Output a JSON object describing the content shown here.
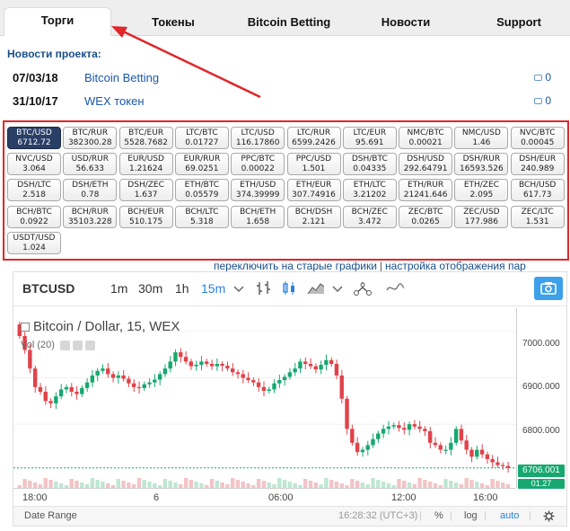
{
  "tabs": [
    "Торги",
    "Токены",
    "Bitcoin Betting",
    "Новости",
    "Support"
  ],
  "news": {
    "title": "Новости проекта:",
    "items": [
      {
        "date": "07/03/18",
        "text": "Bitcoin Betting",
        "count": "0"
      },
      {
        "date": "31/10/17",
        "text": "WEX токен",
        "count": "0"
      }
    ]
  },
  "pairs": [
    {
      "name": "BTC/USD",
      "price": "6712.72",
      "active": true
    },
    {
      "name": "BTC/RUR",
      "price": "382300.28"
    },
    {
      "name": "BTC/EUR",
      "price": "5528.7682"
    },
    {
      "name": "LTC/BTC",
      "price": "0.01727"
    },
    {
      "name": "LTC/USD",
      "price": "116.17860"
    },
    {
      "name": "LTC/RUR",
      "price": "6599.2426"
    },
    {
      "name": "LTC/EUR",
      "price": "95.691"
    },
    {
      "name": "NMC/BTC",
      "price": "0.00021"
    },
    {
      "name": "NMC/USD",
      "price": "1.46"
    },
    {
      "name": "NVC/BTC",
      "price": "0.00045"
    },
    {
      "name": "NVC/USD",
      "price": "3.064"
    },
    {
      "name": "USD/RUR",
      "price": "56.633"
    },
    {
      "name": "EUR/USD",
      "price": "1.21624"
    },
    {
      "name": "EUR/RUR",
      "price": "69.0251"
    },
    {
      "name": "PPC/BTC",
      "price": "0.00022"
    },
    {
      "name": "PPC/USD",
      "price": "1.501"
    },
    {
      "name": "DSH/BTC",
      "price": "0.04335"
    },
    {
      "name": "DSH/USD",
      "price": "292.64791"
    },
    {
      "name": "DSH/RUR",
      "price": "16593.526"
    },
    {
      "name": "DSH/EUR",
      "price": "240.989"
    },
    {
      "name": "DSH/LTC",
      "price": "2.518"
    },
    {
      "name": "DSH/ETH",
      "price": "0.78"
    },
    {
      "name": "DSH/ZEC",
      "price": "1.637"
    },
    {
      "name": "ETH/BTC",
      "price": "0.05579"
    },
    {
      "name": "ETH/USD",
      "price": "374.39999"
    },
    {
      "name": "ETH/EUR",
      "price": "307.74916"
    },
    {
      "name": "ETH/LTC",
      "price": "3.21202"
    },
    {
      "name": "ETH/RUR",
      "price": "21241.646"
    },
    {
      "name": "ETH/ZEC",
      "price": "2.095"
    },
    {
      "name": "BCH/USD",
      "price": "617.73"
    },
    {
      "name": "BCH/BTC",
      "price": "0.0922"
    },
    {
      "name": "BCH/RUR",
      "price": "35103.228"
    },
    {
      "name": "BCH/EUR",
      "price": "510.175"
    },
    {
      "name": "BCH/LTC",
      "price": "5.318"
    },
    {
      "name": "BCH/ETH",
      "price": "1.658"
    },
    {
      "name": "BCH/DSH",
      "price": "2.121"
    },
    {
      "name": "BCH/ZEC",
      "price": "3.472"
    },
    {
      "name": "ZEC/BTC",
      "price": "0.0265"
    },
    {
      "name": "ZEC/USD",
      "price": "177.986"
    },
    {
      "name": "ZEC/LTC",
      "price": "1.531"
    },
    {
      "name": "USDT/USD",
      "price": "1.024"
    }
  ],
  "links": {
    "old_charts": "переключить на старые графики",
    "separator": "|",
    "settings": "настройка отображения пар"
  },
  "chart": {
    "symbol": "BTCUSD",
    "intervals": [
      "1m",
      "30m",
      "1h",
      "15m"
    ],
    "active_interval": "15m",
    "legend": "Bitcoin / Dollar, 15, WEX",
    "volume_legend": "Vol (20)",
    "y_ticks": [
      "7000.000",
      "6900.000",
      "6800.000"
    ],
    "last_price": "6706.001",
    "vol_tag": "01.27",
    "x_ticks": [
      "18:00",
      "6",
      "06:00",
      "12:00",
      "16:00"
    ],
    "bottom": {
      "date_range": "Date Range",
      "time": "16:28:32 (UTC+3)",
      "percent": "%",
      "log": "log",
      "auto": "auto"
    },
    "colors": {
      "up": "#16a870",
      "down": "#e0424a",
      "accent": "#2b80d8"
    }
  },
  "chart_data": {
    "type": "candlestick",
    "symbol": "BTCUSD",
    "interval": "15",
    "ylim": [
      6690,
      7050
    ],
    "y_ticks": [
      7000,
      6900,
      6800
    ],
    "last_price": 6706.001,
    "x_ticks": [
      "18:00",
      "6",
      "06:00",
      "12:00",
      "16:00"
    ],
    "close": [
      6990,
      6960,
      6920,
      6880,
      6870,
      6850,
      6845,
      6860,
      6875,
      6880,
      6870,
      6865,
      6878,
      6890,
      6905,
      6915,
      6920,
      6908,
      6900,
      6905,
      6898,
      6888,
      6880,
      6878,
      6886,
      6890,
      6896,
      6908,
      6920,
      6935,
      6955,
      6945,
      6935,
      6925,
      6928,
      6935,
      6930,
      6925,
      6930,
      6926,
      6920,
      6912,
      6908,
      6900,
      6895,
      6890,
      6880,
      6872,
      6875,
      6888,
      6895,
      6902,
      6912,
      6920,
      6935,
      6930,
      6925,
      6918,
      6928,
      6938,
      6930,
      6905,
      6855,
      6790,
      6760,
      6740,
      6745,
      6755,
      6768,
      6780,
      6790,
      6795,
      6798,
      6792,
      6788,
      6800,
      6795,
      6790,
      6785,
      6760,
      6755,
      6745,
      6745,
      6760,
      6790,
      6765,
      6745,
      6730,
      6745,
      6735,
      6725,
      6718,
      6712,
      6710,
      6706
    ]
  }
}
